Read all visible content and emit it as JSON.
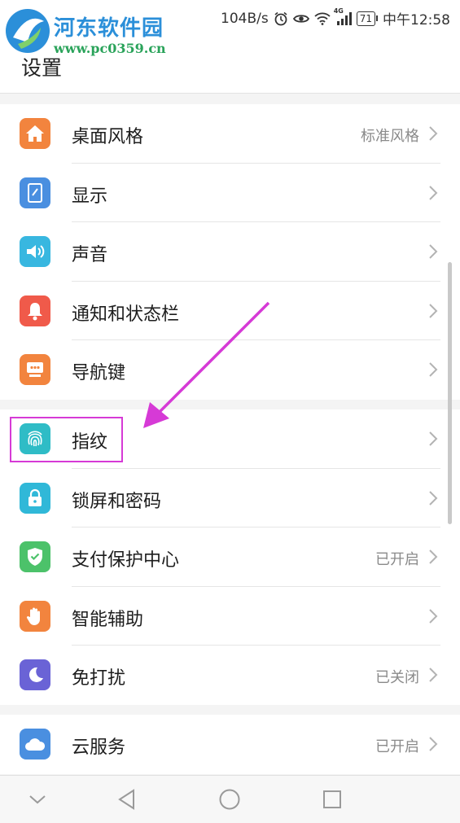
{
  "watermark": {
    "title": "河东软件园",
    "url": "www.pc0359.cn"
  },
  "status_bar": {
    "speed": "104B/s",
    "network": "4G",
    "battery": "71",
    "time": "中午12:58"
  },
  "header": {
    "title": "设置"
  },
  "groups": [
    [
      {
        "label": "桌面风格",
        "value": "标准风格",
        "icon": "home-icon",
        "color": "#f2843e"
      },
      {
        "label": "显示",
        "value": "",
        "icon": "display-icon",
        "color": "#4a8fe0"
      },
      {
        "label": "声音",
        "value": "",
        "icon": "speaker-icon",
        "color": "#38b7e0"
      },
      {
        "label": "通知和状态栏",
        "value": "",
        "icon": "bell-icon",
        "color": "#f05a4a"
      },
      {
        "label": "导航键",
        "value": "",
        "icon": "navigation-key-icon",
        "color": "#f2843e"
      }
    ],
    [
      {
        "label": "指纹",
        "value": "",
        "icon": "fingerprint-icon",
        "color": "#2fbcc6"
      },
      {
        "label": "锁屏和密码",
        "value": "",
        "icon": "lock-icon",
        "color": "#30b8d8"
      },
      {
        "label": "支付保护中心",
        "value": "已开启",
        "icon": "shield-check-icon",
        "color": "#4cc26a"
      },
      {
        "label": "智能辅助",
        "value": "",
        "icon": "hand-icon",
        "color": "#f2843e"
      },
      {
        "label": "免打扰",
        "value": "已关闭",
        "icon": "moon-icon",
        "color": "#6a63d6"
      }
    ],
    [
      {
        "label": "云服务",
        "value": "已开启",
        "icon": "cloud-icon",
        "color": "#4a8fe0"
      }
    ]
  ],
  "colors": {
    "highlight": "#d63ad6",
    "arrow": "#d63ad6"
  }
}
